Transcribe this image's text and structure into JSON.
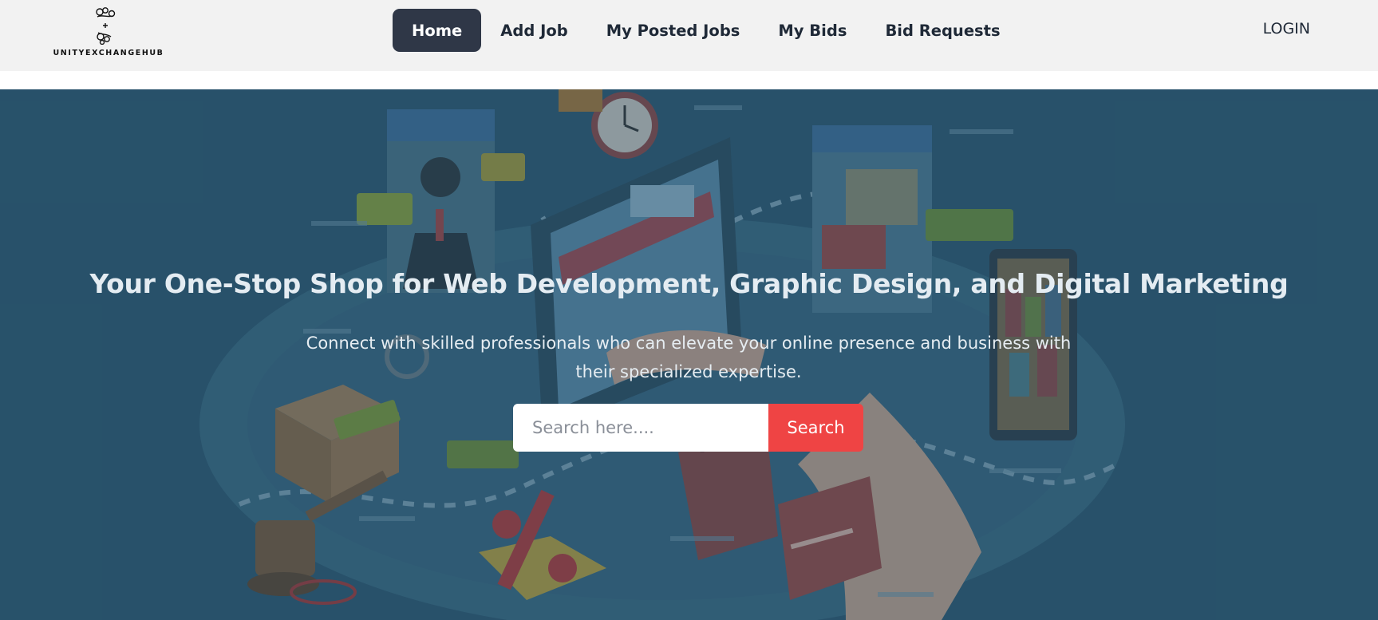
{
  "brand": {
    "name": "UNITYEXCHANGEHUB",
    "logo_icon": "unity-knot-logo"
  },
  "nav": {
    "items": [
      {
        "label": "Home",
        "active": true
      },
      {
        "label": "Add Job",
        "active": false
      },
      {
        "label": "My Posted Jobs",
        "active": false
      },
      {
        "label": "My Bids",
        "active": false
      },
      {
        "label": "Bid Requests",
        "active": false
      }
    ],
    "login_label": "LOGIN"
  },
  "hero": {
    "title": "Your One-Stop Shop for Web Development, Graphic Design, and Digital Marketing",
    "subtitle": "Connect with skilled professionals who can elevate your online presence and business with their specialized expertise.",
    "search": {
      "placeholder": "Search here....",
      "value": "",
      "button_label": "Search"
    },
    "background_illustration": "isometric-ecommerce-illustration"
  },
  "colors": {
    "navbar_bg": "#f2f2f2",
    "active_nav_bg": "#2f3747",
    "hero_tint": "#2e5870",
    "search_button": "#ef4444"
  }
}
